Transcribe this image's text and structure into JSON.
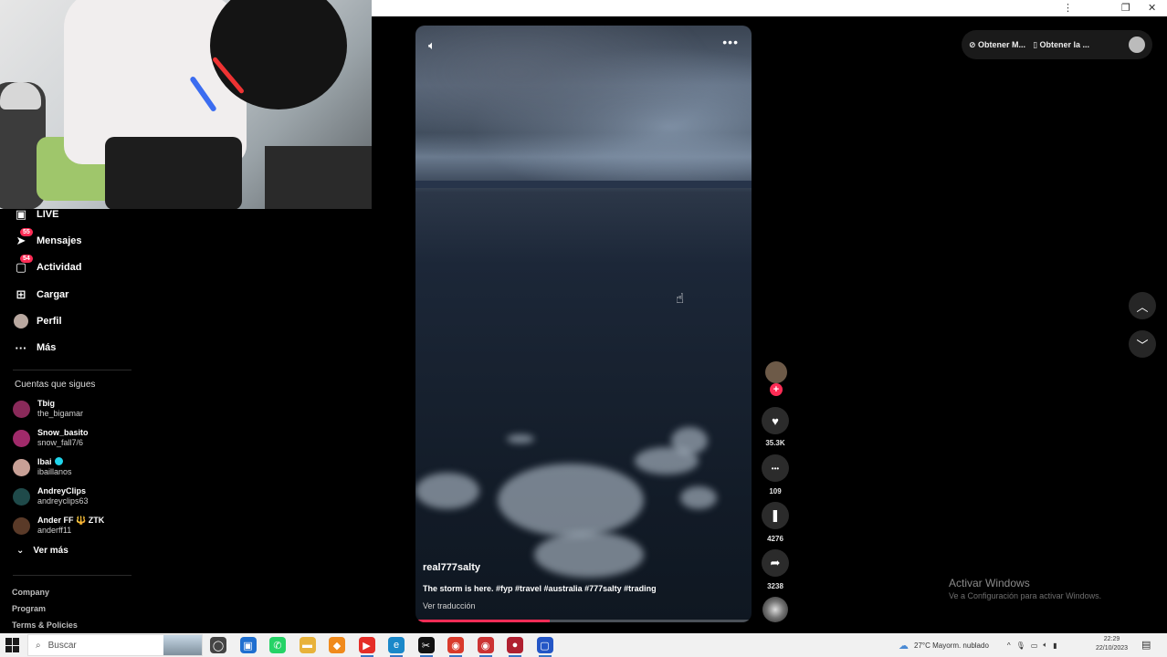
{
  "window": {
    "controls": [
      "⋮",
      "❐",
      "✕"
    ]
  },
  "webcam": {
    "label": "webcam overlay"
  },
  "sidebar": {
    "items": [
      {
        "label": "LIVE",
        "icon": "live-icon",
        "badge": ""
      },
      {
        "label": "Mensajes",
        "icon": "messages-icon",
        "badge": "55"
      },
      {
        "label": "Actividad",
        "icon": "activity-icon",
        "badge": "54"
      },
      {
        "label": "Cargar",
        "icon": "upload-icon",
        "badge": ""
      },
      {
        "label": "Perfil",
        "icon": "profile-icon",
        "badge": ""
      },
      {
        "label": "Más",
        "icon": "more-icon",
        "badge": ""
      }
    ],
    "following_title": "Cuentas que sigues",
    "accounts": [
      {
        "name": "Tbig",
        "handle": "the_bigamar",
        "color": "#8a2a5a",
        "verified": false
      },
      {
        "name": "Snow_basito",
        "handle": "snow_fall7/6",
        "color": "#a02a6a",
        "verified": false
      },
      {
        "name": "Ibai",
        "handle": "ibaillanos",
        "color": "#c8a096",
        "verified": true
      },
      {
        "name": "AndreyClips",
        "handle": "andreyclips63",
        "color": "#1f4a4a",
        "verified": false
      },
      {
        "name": "Ander FF 🔱 ZTK",
        "handle": "anderff11",
        "color": "#5a3a28",
        "verified": false
      }
    ],
    "see_more": "Ver más",
    "footer": [
      "Company",
      "Program",
      "Terms & Policies"
    ]
  },
  "video": {
    "author": "real777salty",
    "caption": "The storm is here. #fyp #travel #australia #777salty #trading",
    "translate": "Ver traducción",
    "progress": 0.4
  },
  "actions": [
    {
      "name": "like",
      "icon": "♥",
      "count": "35.3K"
    },
    {
      "name": "comment",
      "icon": "•••",
      "count": "109"
    },
    {
      "name": "save",
      "icon": "❚",
      "count": "4276"
    },
    {
      "name": "share",
      "icon": "➦",
      "count": "3238"
    }
  ],
  "top_actions": {
    "get_coins": "Obtener M...",
    "get_app": "Obtener la ..."
  },
  "watermark": {
    "line1": "Activar Windows",
    "line2": "Ve a Configuración para activar Windows."
  },
  "taskbar": {
    "search_placeholder": "Buscar",
    "weather": "27°C  Mayorm. nublado",
    "time": "22:29",
    "date": "22/10/2023",
    "apps": [
      {
        "name": "task-view",
        "color": "#444",
        "glyph": "◯"
      },
      {
        "name": "widgets",
        "color": "#1f6fd0",
        "glyph": "▣"
      },
      {
        "name": "whatsapp",
        "color": "#25d366",
        "glyph": "✆"
      },
      {
        "name": "file-explorer",
        "color": "#e8b23a",
        "glyph": "▬"
      },
      {
        "name": "app-orange",
        "color": "#f08a1c",
        "glyph": "◆"
      },
      {
        "name": "youtube",
        "color": "#e52d27",
        "glyph": "▶"
      },
      {
        "name": "edge",
        "color": "#1a88c9",
        "glyph": "e"
      },
      {
        "name": "capcut",
        "color": "#111",
        "glyph": "✂"
      },
      {
        "name": "chrome",
        "color": "#d93a2b",
        "glyph": "◉"
      },
      {
        "name": "chrome-2",
        "color": "#c33",
        "glyph": "◉"
      },
      {
        "name": "app-red",
        "color": "#b02030",
        "glyph": "●"
      },
      {
        "name": "app-blue",
        "color": "#2456c6",
        "glyph": "▢"
      }
    ]
  }
}
